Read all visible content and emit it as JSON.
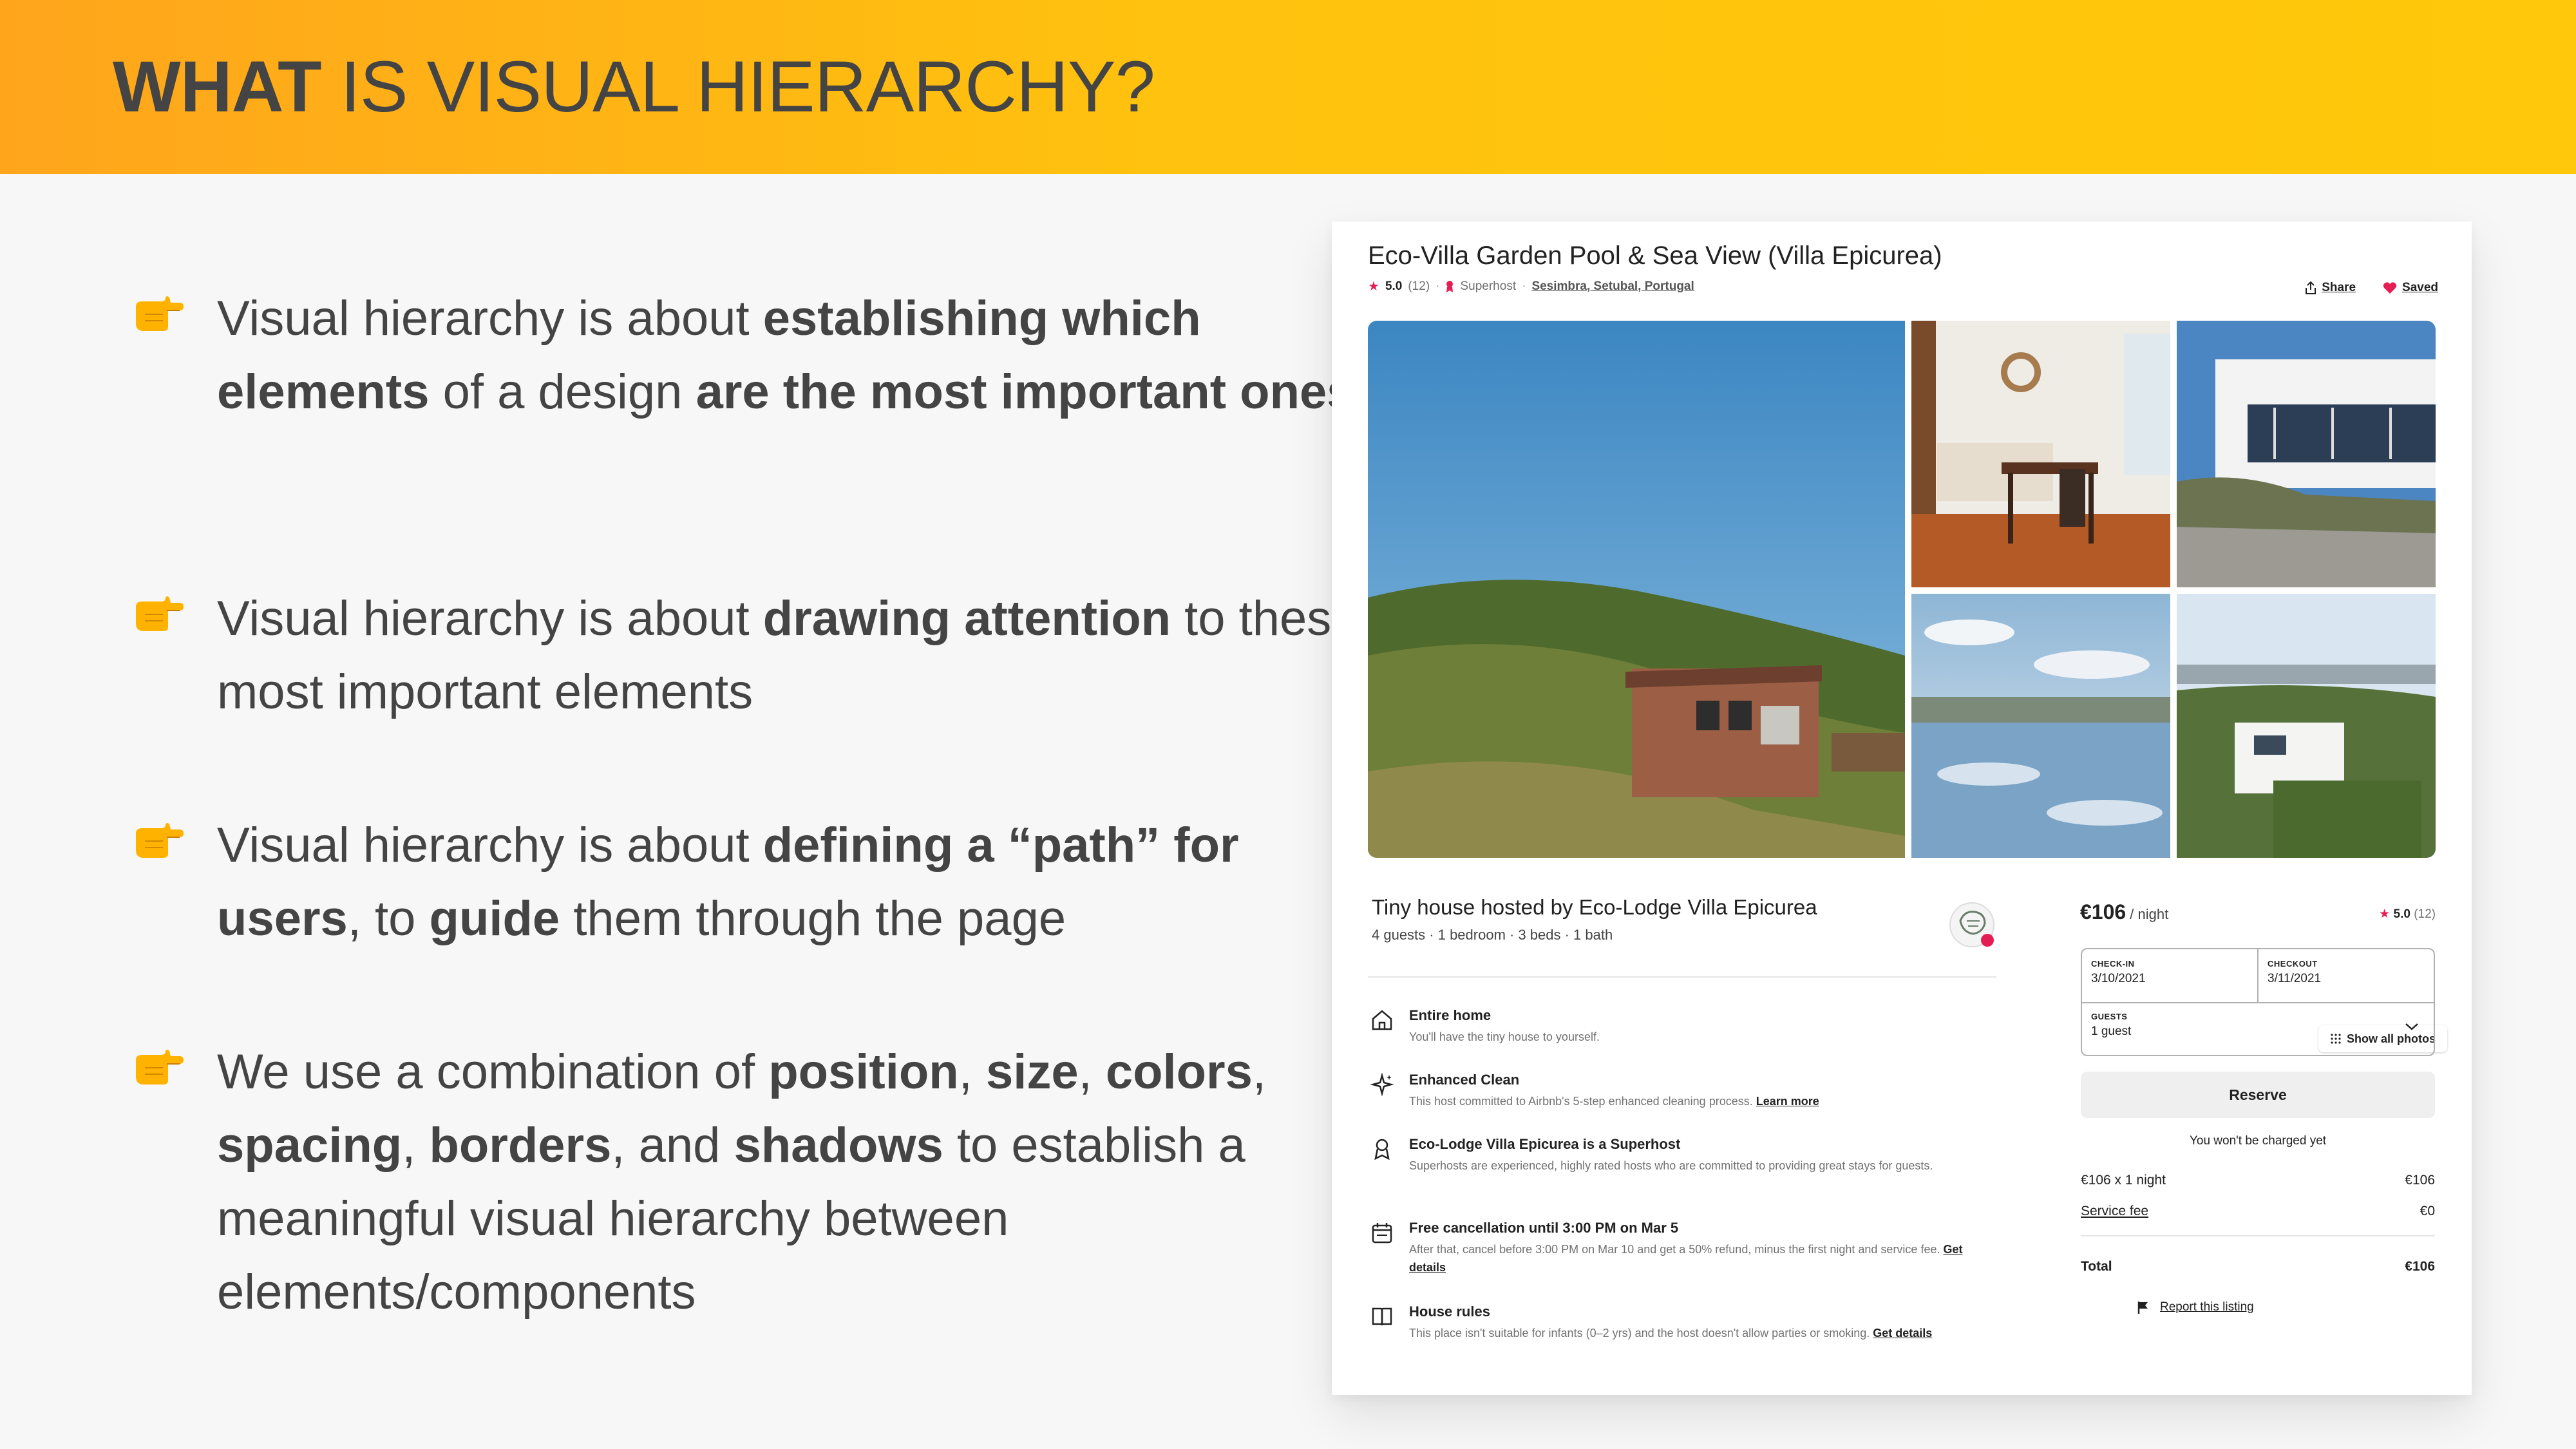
{
  "header": {
    "title_bold": "WHAT",
    "title_rest": " IS VISUAL HIERARCHY?"
  },
  "bullets": [
    {
      "icon": "pointing-right-hand-icon",
      "parts": [
        {
          "t": "Visual hierarchy is about ",
          "b": false
        },
        {
          "t": "establishing which elements",
          "b": true
        },
        {
          "t": " of a design ",
          "b": false
        },
        {
          "t": "are the most important ones",
          "b": true
        }
      ]
    },
    {
      "icon": "pointing-right-hand-icon",
      "parts": [
        {
          "t": "Visual hierarchy is about ",
          "b": false
        },
        {
          "t": "drawing attention",
          "b": true
        },
        {
          "t": " to these most important elements",
          "b": false
        }
      ]
    },
    {
      "icon": "pointing-right-hand-icon",
      "parts": [
        {
          "t": "Visual hierarchy is about ",
          "b": false
        },
        {
          "t": "defining a “path” for users",
          "b": true
        },
        {
          "t": ", to ",
          "b": false
        },
        {
          "t": "guide",
          "b": true
        },
        {
          "t": " them through the page",
          "b": false
        }
      ]
    },
    {
      "icon": "pointing-right-hand-icon",
      "parts": [
        {
          "t": "We use a combination of ",
          "b": false
        },
        {
          "t": "position",
          "b": true
        },
        {
          "t": ", ",
          "b": false
        },
        {
          "t": "size",
          "b": true
        },
        {
          "t": ", ",
          "b": false
        },
        {
          "t": "colors",
          "b": true
        },
        {
          "t": ", ",
          "b": false
        },
        {
          "t": "spacing",
          "b": true
        },
        {
          "t": ", ",
          "b": false
        },
        {
          "t": "borders",
          "b": true
        },
        {
          "t": ", and ",
          "b": false
        },
        {
          "t": "shadows",
          "b": true
        },
        {
          "t": " to establish a meaningful visual hierarchy between elements/components",
          "b": false
        }
      ]
    }
  ],
  "listing": {
    "title": "Eco-Villa Garden Pool & Sea View (Villa Epicurea)",
    "rating": "5.0",
    "review_count": "(12)",
    "superhost": "Superhost",
    "location": "Sesimbra, Setubal, Portugal",
    "share_label": "Share",
    "saved_label": "Saved",
    "show_all_photos": "Show all photos",
    "host_title": "Tiny house hosted by Eco-Lodge Villa Epicurea",
    "host_sub": "4 guests · 1 bedroom · 3 beds · 1 bath",
    "features": [
      {
        "icon": "home-icon",
        "title": "Entire home",
        "desc": "You'll have the tiny house to yourself.",
        "link": ""
      },
      {
        "icon": "sparkles-icon",
        "title": "Enhanced Clean",
        "desc": "This host committed to Airbnb's 5-step enhanced cleaning process. ",
        "link": "Learn more"
      },
      {
        "icon": "medal-icon",
        "title": "Eco-Lodge Villa Epicurea is a Superhost",
        "desc": "Superhosts are experienced, highly rated hosts who are committed to providing great stays for guests.",
        "link": ""
      },
      {
        "icon": "calendar-icon",
        "title": "Free cancellation until 3:00 PM on Mar 5",
        "desc": "After that, cancel before 3:00 PM on Mar 10 and get a 50% refund, minus the first night and service fee. ",
        "link": "Get details"
      },
      {
        "icon": "book-icon",
        "title": "House rules",
        "desc": "This place isn't suitable for infants (0–2 yrs) and the host doesn't allow parties or smoking. ",
        "link": "Get details"
      }
    ]
  },
  "booking": {
    "price": "€106",
    "per_night": " / night",
    "rating": "5.0",
    "review_count": "(12)",
    "checkin_label": "CHECK-IN",
    "checkin_value": "3/10/2021",
    "checkout_label": "CHECKOUT",
    "checkout_value": "3/11/2021",
    "guests_label": "GUESTS",
    "guests_value": "1 guest",
    "reserve_label": "Reserve",
    "not_charged": "You won't be charged yet",
    "nightly_label": "€106 x 1 night",
    "nightly_value": "€106",
    "service_fee_label": "Service fee",
    "service_fee_value": "€0",
    "total_label": "Total",
    "total_value": "€106",
    "report_label": "Report this listing"
  },
  "colors": {
    "banner_start": "#ffa51c",
    "banner_end": "#ffc80a",
    "airbnb_pink": "#e51d55",
    "text": "#444444"
  }
}
